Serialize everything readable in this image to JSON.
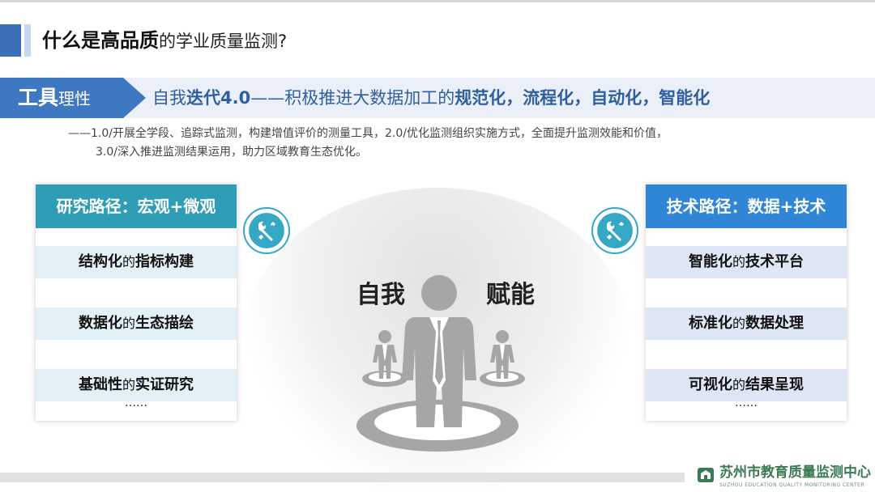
{
  "title": {
    "bold": "什么是高品质",
    "normal": "的学业质量监测?"
  },
  "banner": {
    "tag_bold": "工具",
    "tag_normal": "理性",
    "p1": "自我",
    "p2": "迭代4.0",
    "p3": "——积极推进大数据加工的",
    "p4": "规范化",
    "p5": "，",
    "p6": "流程化",
    "p7": "，",
    "p8": "自动化",
    "p9": "，",
    "p10": "智能化"
  },
  "description": {
    "line1": "——1.0/开展全学段、追踪式监测，构建增值评价的测量工具，2.0/优化监测组织实施方式，全面提升监测效能和价值，",
    "line2": "3.0/深入推进监测结果运用，助力区域教育生态优化。"
  },
  "left_panel": {
    "heading": "研究路径：宏观+微观",
    "items": [
      {
        "bold": "结构化",
        "normal": "的",
        "bold2": "指标构建"
      },
      {
        "bold": "数据化",
        "normal": "的",
        "bold2": "生态描绘"
      },
      {
        "bold": "基础性",
        "normal": "的",
        "bold2": "实证研究"
      }
    ],
    "more": "……"
  },
  "right_panel": {
    "heading": "技术路径：数据+技术",
    "items": [
      {
        "bold": "智能化",
        "normal": "的",
        "bold2": "技术平台"
      },
      {
        "bold": "标准化",
        "normal": "的",
        "bold2": "数据处理"
      },
      {
        "bold": "可视化",
        "normal": "的",
        "bold2": "结果呈现"
      }
    ],
    "more": "……"
  },
  "center": {
    "left_word": "自我",
    "right_word": "赋能"
  },
  "footer": {
    "org_name": "苏州市教育质量监测中心",
    "org_sub": "SUZHOU EDUCATION QUALITY MONITORING CENTER"
  },
  "colors": {
    "accent_blue": "#3f78c2",
    "left_head": "#2f9db5",
    "left_row": "#e3f1f6",
    "right_head": "#2f86d6",
    "right_row": "#dfe6f6",
    "icon_teal": "#37a7c6"
  },
  "icons": {
    "left_tool": "wrench-screwdriver-icon",
    "right_tool": "wrench-screwdriver-icon",
    "figure": "person-icon",
    "logo": "building-logo-icon"
  }
}
